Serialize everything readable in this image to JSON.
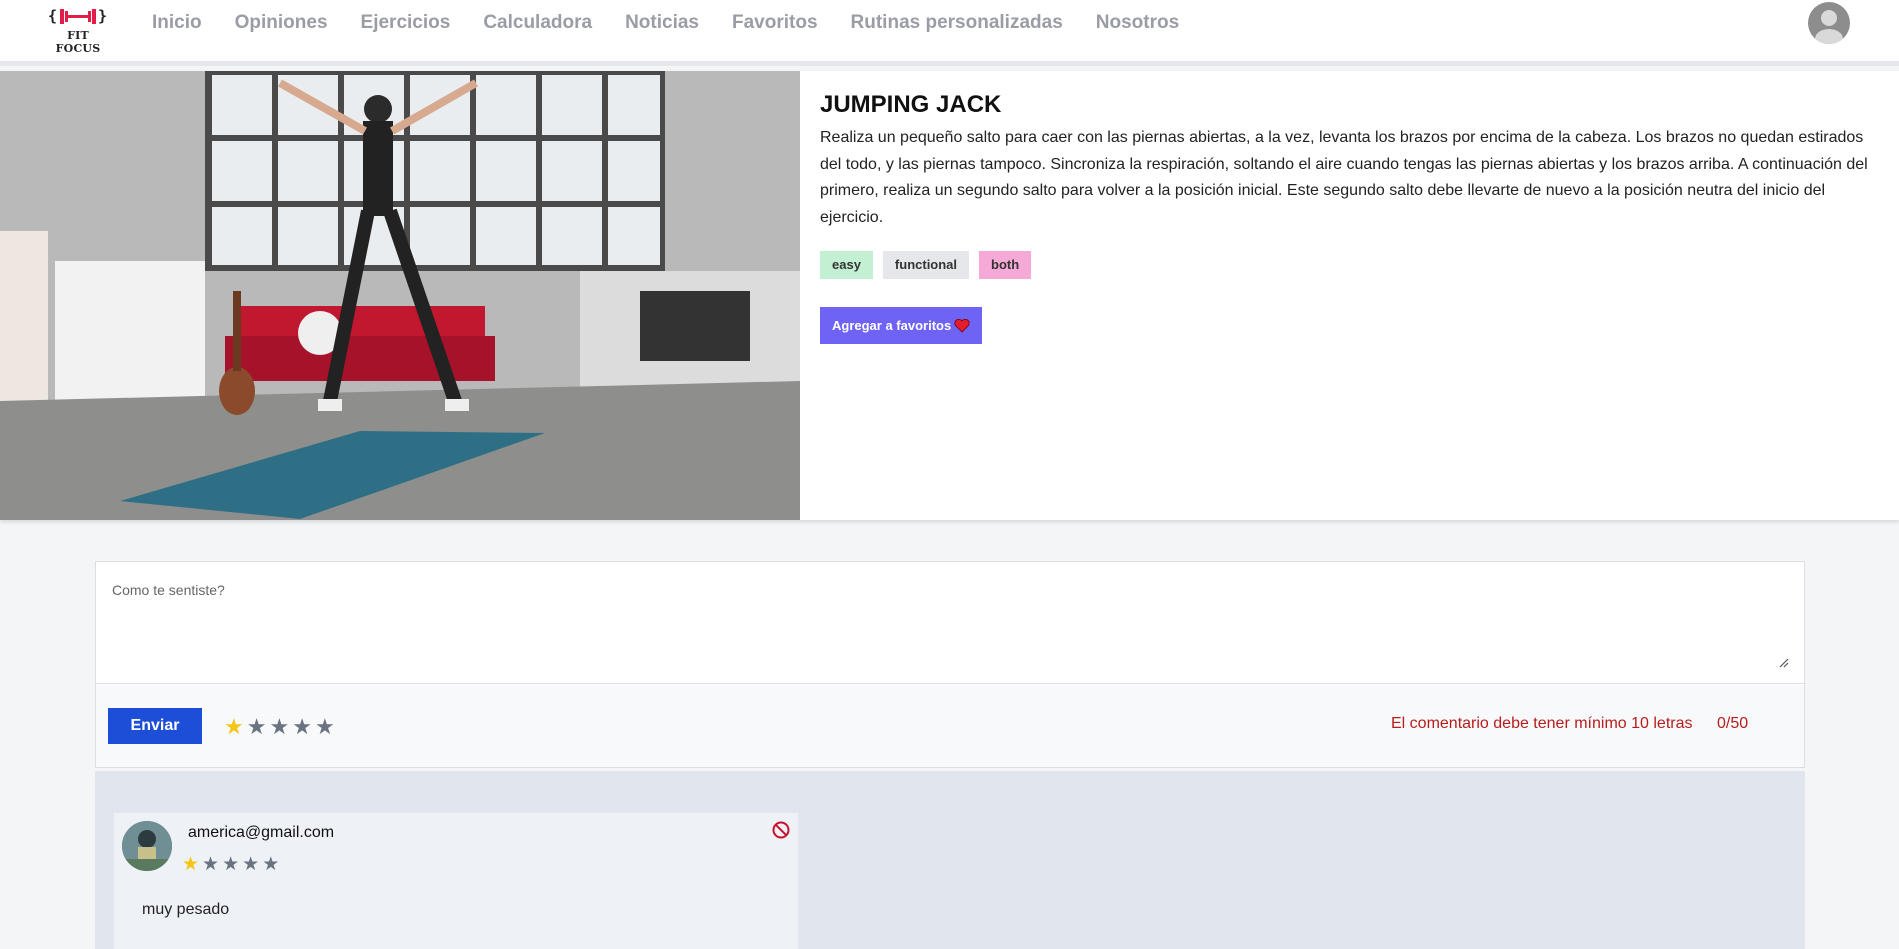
{
  "brand": {
    "logo_text": "FIT FOCUS",
    "logo_glyph": "{<|>}"
  },
  "nav": {
    "items": [
      "Inicio",
      "Opiniones",
      "Ejercicios",
      "Calculadora",
      "Noticias",
      "Favoritos",
      "Rutinas personalizadas",
      "Nosotros"
    ]
  },
  "exercise": {
    "title": "JUMPING JACK",
    "description": "Realiza un pequeño salto para caer con las piernas abiertas, a la vez, levanta los brazos por encima de la cabeza. Los brazos no quedan estirados del todo, y las piernas tampoco. Sincroniza la respiración, soltando el aire cuando tengas las piernas abiertas y los brazos arriba. A continuación del primero, realiza un segundo salto para volver a la posición inicial. Este segundo salto debe llevarte de nuevo a la posición neutra del inicio del ejercicio.",
    "tags": [
      "easy",
      "functional",
      "both"
    ],
    "favorite_label": "Agregar a favoritos",
    "favorite_icon": "heart-icon"
  },
  "comment_form": {
    "placeholder": "Como te sentiste?",
    "send_label": "Enviar",
    "rating": 1,
    "rating_max": 5,
    "error": "El comentario debe tener mínimo 10 letras",
    "counter": "0/50"
  },
  "comments": [
    {
      "email": "america@gmail.com",
      "rating": 1,
      "rating_max": 5,
      "text": "muy pesado"
    }
  ],
  "colors": {
    "accent": "#6f63f6",
    "send_button": "#1d4ed8",
    "error": "#b91c1c",
    "star_on": "#f5c518",
    "star_off": "#6b7280",
    "tag_easy": "#c3f0d3",
    "tag_functional": "#e5e7eb",
    "tag_both": "#f4a9d6"
  }
}
